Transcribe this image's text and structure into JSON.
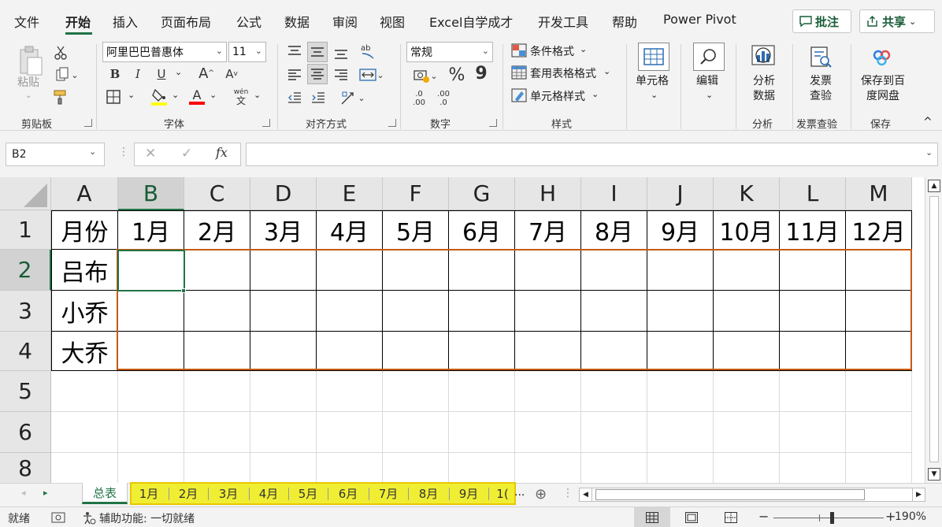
{
  "menu": {
    "tabs": [
      "文件",
      "开始",
      "插入",
      "页面布局",
      "公式",
      "数据",
      "审阅",
      "视图",
      "Excel自学成才",
      "开发工具",
      "帮助",
      "Power Pivot"
    ],
    "comment_btn": "批注",
    "share_btn": "共享"
  },
  "ribbon": {
    "clipboard": {
      "paste": "粘贴",
      "label": "剪贴板"
    },
    "font": {
      "name": "阿里巴巴普惠体",
      "size": "11",
      "label": "字体",
      "wen": "wén",
      "wen_char": "文"
    },
    "align": {
      "label": "对齐方式"
    },
    "number": {
      "format": "常规",
      "label": "数字",
      "percent": "%",
      "comma": "9",
      "inc_top": ".0",
      "inc_bot": ".00",
      "dec_top": ".00",
      "dec_bot": ".0"
    },
    "styles": {
      "cond": "条件格式",
      "table": "套用表格格式",
      "cell": "单元格样式",
      "label": "样式"
    },
    "cells": {
      "label": "单元格"
    },
    "editing": {
      "label": "编辑"
    },
    "analysis": {
      "btn": "分析数据",
      "label": "分析"
    },
    "invoice": {
      "btn": "发票查验",
      "label": "发票查验"
    },
    "save": {
      "btn": "保存到百度网盘",
      "label": "保存"
    }
  },
  "formula_bar": {
    "name_box": "B2",
    "fx": "fx",
    "cancel": "✕",
    "enter": "✓"
  },
  "grid": {
    "columns": [
      "A",
      "B",
      "C",
      "D",
      "E",
      "F",
      "G",
      "H",
      "I",
      "J",
      "K",
      "L",
      "M"
    ],
    "rows": [
      "1",
      "2",
      "3",
      "4",
      "5",
      "6",
      "8"
    ],
    "cells": {
      "A1": "月份",
      "B1": "1月",
      "C1": "2月",
      "D1": "3月",
      "E1": "4月",
      "F1": "5月",
      "G1": "6月",
      "H1": "7月",
      "I1": "8月",
      "J1": "9月",
      "K1": "10月",
      "L1": "11月",
      "M1": "12月",
      "A2": "吕布",
      "A3": "小乔",
      "A4": "大乔"
    }
  },
  "sheets": {
    "tabs": [
      "总表",
      "1月",
      "2月",
      "3月",
      "4月",
      "5月",
      "6月",
      "7月",
      "8月",
      "9月",
      "1("
    ],
    "overflow": "...",
    "active": "总表"
  },
  "status": {
    "ready": "就绪",
    "accessibility": "辅助功能: 一切就绪",
    "zoom": "190%"
  },
  "colors": {
    "accent": "#217346",
    "highlight": "#f0ee33",
    "border_orange": "#c55a11"
  }
}
